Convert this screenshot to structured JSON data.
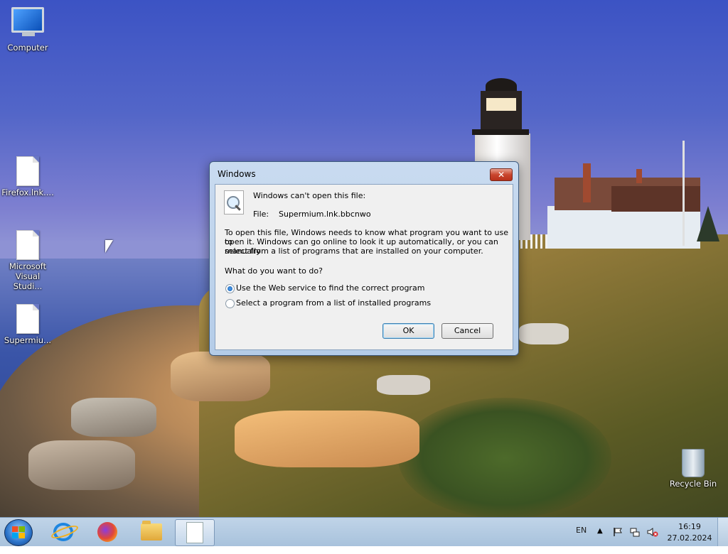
{
  "desktop": {
    "icons": [
      {
        "label": "Computer",
        "icon": "computer-icon"
      },
      {
        "label": "Firefox.lnk....",
        "icon": "file-icon"
      },
      {
        "label": "Microsoft Visual Studi...",
        "icon": "file-icon"
      },
      {
        "label": "Supermiu...",
        "icon": "file-icon"
      },
      {
        "label": "Recycle Bin",
        "icon": "recycle-bin-icon"
      }
    ]
  },
  "dialog": {
    "title": "Windows",
    "close_label": "✕",
    "heading": "Windows can't open this file:",
    "file_label": "File:",
    "file_name": "Supermium.lnk.bbcnwo",
    "explanation_line1": "To open this file, Windows needs to know what program you want to use to",
    "explanation_line2": "open it. Windows can go online to look it up automatically, or you can manually",
    "explanation_line3": "select from a list of programs that are installed on your computer.",
    "question": "What do you want to do?",
    "options": [
      {
        "label": "Use the Web service to find the correct program",
        "selected": true
      },
      {
        "label": "Select a program from a list of installed programs",
        "selected": false
      }
    ],
    "ok_label": "OK",
    "cancel_label": "Cancel"
  },
  "taskbar": {
    "pinned": [
      "internet-explorer-icon",
      "firefox-icon",
      "file-explorer-icon",
      "document-icon"
    ],
    "language": "EN",
    "time": "16:19",
    "date": "27.02.2024"
  }
}
